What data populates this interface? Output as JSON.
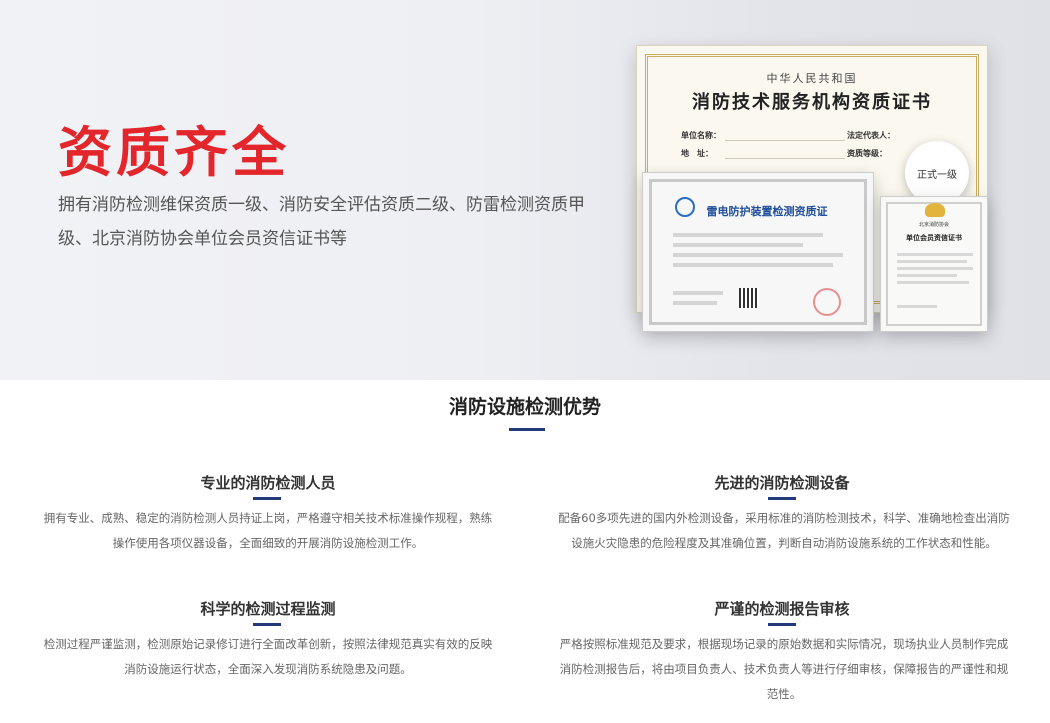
{
  "hero": {
    "title": "资质齐全",
    "description": "拥有消防检测维保资质一级、消防安全评估资质二级、防雷检测资质甲级、北京消防协会单位会员资信证书等"
  },
  "certificates": {
    "main": {
      "country": "中华人民共和国",
      "name": "消防技术服务机构资质证书",
      "field_unit": "单位名称：",
      "field_legal": "法定代表人：",
      "field_addr": "地　址：",
      "field_level": "资质等级：",
      "level": "正式一级"
    },
    "lightning": {
      "name": "雷电防护装置检测资质证"
    },
    "association": {
      "org": "北京消防协会",
      "name": "单位会员资信证书"
    }
  },
  "section": {
    "title": "消防设施检测优势"
  },
  "advantages": [
    {
      "title": "专业的消防检测人员",
      "desc_line1": "拥有专业、成熟、稳定的消防检测人员持证上岗，严格遵守相关技术标准操作规程，熟练",
      "desc_line2": "操作使用各项仪器设备，全面细致的开展消防设施检测工作。"
    },
    {
      "title": "先进的消防检测设备",
      "desc_line1": "配备60多项先进的国内外检测设备，采用标准的消防检测技术，科学、准确地检查出消防",
      "desc_line2": "设施火灾隐患的危险程度及其准确位置，判断自动消防设施系统的工作状态和性能。"
    },
    {
      "title": "科学的检测过程监测",
      "desc_line1": "检测过程严谨监测，检测原始记录修订进行全面改革创新，按照法律规范真实有效的反映",
      "desc_line2": "消防设施运行状态，全面深入发现消防系统隐患及问题。"
    },
    {
      "title": "严谨的检测报告审核",
      "desc_line1": "严格按照标准规范及要求，根据现场记录的原始数据和实际情况，现场执业人员制作完成",
      "desc_line2": "消防检测报告后，将由项目负责人、技术负责人等进行仔细审核，保障报告的严谨性和规",
      "desc_line3": "范性。"
    }
  ]
}
